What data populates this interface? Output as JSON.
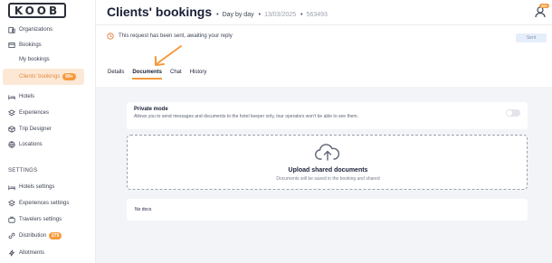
{
  "sidebar": {
    "logo": "KOOB",
    "items": [
      {
        "label": "Organizations",
        "icon": "organizations-icon"
      },
      {
        "label": "Bookings",
        "icon": "bookings-icon"
      },
      {
        "label": "My bookings"
      },
      {
        "label": "Clients' bookings",
        "badge": "99+"
      },
      {
        "label": "Hotels",
        "icon": "bed-icon"
      },
      {
        "label": "Experiences",
        "icon": "layers-icon"
      },
      {
        "label": "Trip Designer",
        "icon": "box-icon"
      },
      {
        "label": "Locations",
        "icon": "globe-icon"
      }
    ],
    "settings_label": "SETTINGS",
    "settings_items": [
      {
        "label": "Hotels settings",
        "icon": "bed-icon"
      },
      {
        "label": "Experiences settings",
        "icon": "layers-icon"
      },
      {
        "label": "Travelers settings",
        "icon": "travelers-icon"
      },
      {
        "label": "Distribution",
        "icon": "link-icon",
        "badge": "275"
      },
      {
        "label": "Allotments",
        "icon": "bolt-icon"
      }
    ]
  },
  "header": {
    "title": "Clients' bookings",
    "crumb1": "Day by day",
    "crumb2": "13/03/2025",
    "crumb3": "563493",
    "user_badge": "99+"
  },
  "notice": {
    "text": "This request has been sent, awaiting your reply",
    "button": "Sent"
  },
  "tabs": [
    {
      "label": "Details",
      "active": false
    },
    {
      "label": "Documents",
      "active": true
    },
    {
      "label": "Chat",
      "active": false
    },
    {
      "label": "History",
      "active": false
    }
  ],
  "private_mode": {
    "title": "Private mode",
    "description": "Allows you to send messages and documents to the hotel keeper only, tour operators won't be able to see them.",
    "enabled": false
  },
  "upload": {
    "title": "Upload shared documents",
    "subtitle": "Documents will be saved in the booking and shared"
  },
  "docs": {
    "empty_text": "No docs"
  },
  "colors": {
    "accent": "#f59a3c",
    "active_bg": "#fde8d6",
    "content_bg": "#f3f4f7"
  }
}
